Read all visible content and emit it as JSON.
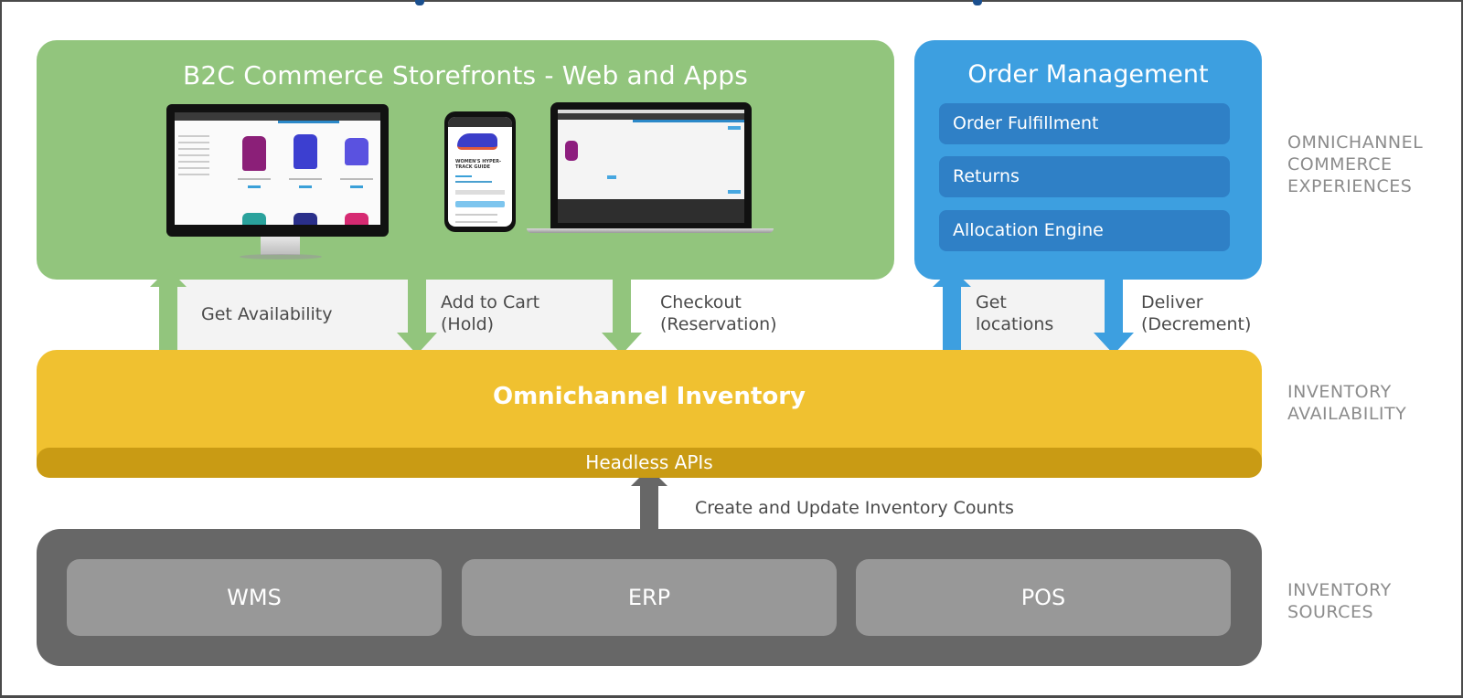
{
  "diagram": {
    "storefront": {
      "title": "B2C Commerce Storefronts - Web and Apps",
      "phone_product_name": "WOMEN'S HYPER-TRACK GUIDE",
      "color": "#92c57d"
    },
    "order_management": {
      "title": "Order Management",
      "items": [
        {
          "label": "Order Fulfillment"
        },
        {
          "label": "Returns"
        },
        {
          "label": "Allocation Engine"
        }
      ],
      "color": "#3d9fe0"
    },
    "flows": [
      {
        "label_line1": "Get Availability",
        "label_line2": "",
        "direction": "up",
        "from": "storefront"
      },
      {
        "label_line1": "Add to Cart",
        "label_line2": "(Hold)",
        "direction": "down",
        "from": "storefront"
      },
      {
        "label_line1": "Checkout",
        "label_line2": "(Reservation)",
        "direction": "down",
        "from": "storefront"
      },
      {
        "label_line1": "Get",
        "label_line2": "locations",
        "direction": "up",
        "from": "order_management"
      },
      {
        "label_line1": "Deliver",
        "label_line2": "(Decrement)",
        "direction": "down",
        "from": "order_management"
      },
      {
        "label_line1": "Create and Update Inventory Counts",
        "label_line2": "",
        "direction": "up",
        "from": "sources"
      }
    ],
    "inventory": {
      "title": "Omnichannel Inventory",
      "api_label": "Headless APIs",
      "color": "#f0c130",
      "api_color": "#c99b14"
    },
    "sources": {
      "items": [
        {
          "label": "WMS"
        },
        {
          "label": "ERP"
        },
        {
          "label": "POS"
        }
      ],
      "color": "#676767"
    },
    "tiers": [
      {
        "line1": "OMNICHANNEL",
        "line2": "COMMERCE",
        "line3": "EXPERIENCES"
      },
      {
        "line1": "INVENTORY",
        "line2": "AVAILABILITY",
        "line3": ""
      },
      {
        "line1": "INVENTORY",
        "line2": "SOURCES",
        "line3": ""
      }
    ]
  }
}
